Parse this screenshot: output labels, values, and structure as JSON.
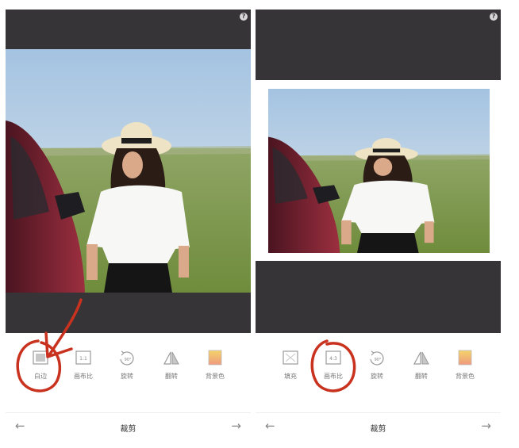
{
  "left_panel": {
    "tools": [
      {
        "label": "白边",
        "icon": "white-border-icon"
      },
      {
        "label": "画布比",
        "icon": "canvas-ratio-icon",
        "badge": "1:1"
      },
      {
        "label": "旋转",
        "icon": "rotate-icon",
        "badge": "90°"
      },
      {
        "label": "翻转",
        "icon": "flip-icon"
      },
      {
        "label": "背景色",
        "icon": "background-color-icon"
      }
    ],
    "bottom_bar": {
      "title": "裁剪",
      "back": "←",
      "forward": "→"
    }
  },
  "right_panel": {
    "tools": [
      {
        "label": "填充",
        "icon": "fill-icon"
      },
      {
        "label": "画布比",
        "icon": "canvas-ratio-icon",
        "badge": "4:3"
      },
      {
        "label": "旋转",
        "icon": "rotate-icon",
        "badge": "90°"
      },
      {
        "label": "翻转",
        "icon": "flip-icon"
      },
      {
        "label": "背景色",
        "icon": "background-color-icon"
      }
    ],
    "bottom_bar": {
      "title": "裁剪",
      "back": "←",
      "forward": "→"
    }
  },
  "help_icon": "?",
  "colors": {
    "editor_background": "#373437",
    "annotation_red": "#c8321e",
    "sky": "#a9c8e4",
    "grass": "#7f9a4a"
  }
}
